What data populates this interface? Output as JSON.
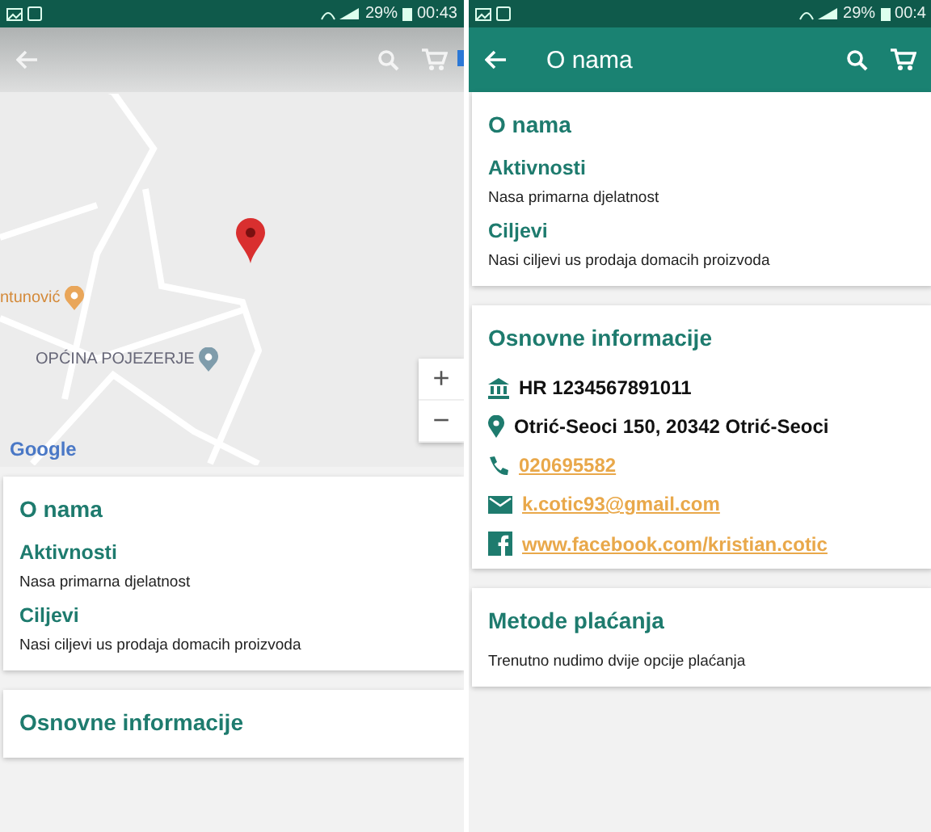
{
  "screens": [
    {
      "kind": "map",
      "status": {
        "battery": "29%",
        "time": "00:43"
      },
      "toolbar": {
        "overlay": true
      },
      "map": {
        "places": [
          {
            "kind": "food",
            "label": "ntunović"
          },
          {
            "kind": "office",
            "label": "OPĆINA POJEZERJE"
          }
        ],
        "credit": "Google",
        "zoom": [
          "+",
          "−"
        ]
      },
      "cards": [
        {
          "title": "O nama",
          "items": [
            {
              "kind": "heading",
              "text": "Aktivnosti"
            },
            {
              "kind": "text",
              "text": "Nasa primarna djelatnost"
            },
            {
              "kind": "heading",
              "text": "Ciljevi"
            },
            {
              "kind": "text",
              "text": "Nasi ciljevi us prodaja domacih proizvoda"
            }
          ]
        },
        {
          "title": "Osnovne informacije"
        }
      ]
    },
    {
      "kind": "page",
      "status": {
        "battery": "29%",
        "time": "00:4"
      },
      "toolbar": {
        "overlay": false,
        "title": "O nama"
      },
      "cards": [
        {
          "title": "O nama",
          "items": [
            {
              "kind": "heading",
              "text": "Aktivnosti"
            },
            {
              "kind": "text",
              "text": "Nasa primarna djelatnost"
            },
            {
              "kind": "heading",
              "text": "Ciljevi"
            },
            {
              "kind": "text",
              "text": "Nasi ciljevi us prodaja domacih proizvoda"
            }
          ]
        },
        {
          "title": "Osnovne informacije",
          "items": [
            {
              "kind": "vat",
              "text": "HR 1234567891011",
              "link": false
            },
            {
              "kind": "address",
              "text": "Otrić-Seoci 150, 20342 Otrić-Seoci",
              "link": false
            },
            {
              "kind": "phone",
              "text": "020695582",
              "link": true
            },
            {
              "kind": "email",
              "text": "k.cotic93@gmail.com",
              "link": true
            },
            {
              "kind": "facebook",
              "text": "www.facebook.com/kristian.cotic",
              "link": true
            }
          ]
        },
        {
          "title": "Metode plaćanja",
          "items": [
            {
              "kind": "text",
              "text": "Trenutno nudimo dvije opcije plaćanja"
            }
          ]
        }
      ]
    }
  ]
}
